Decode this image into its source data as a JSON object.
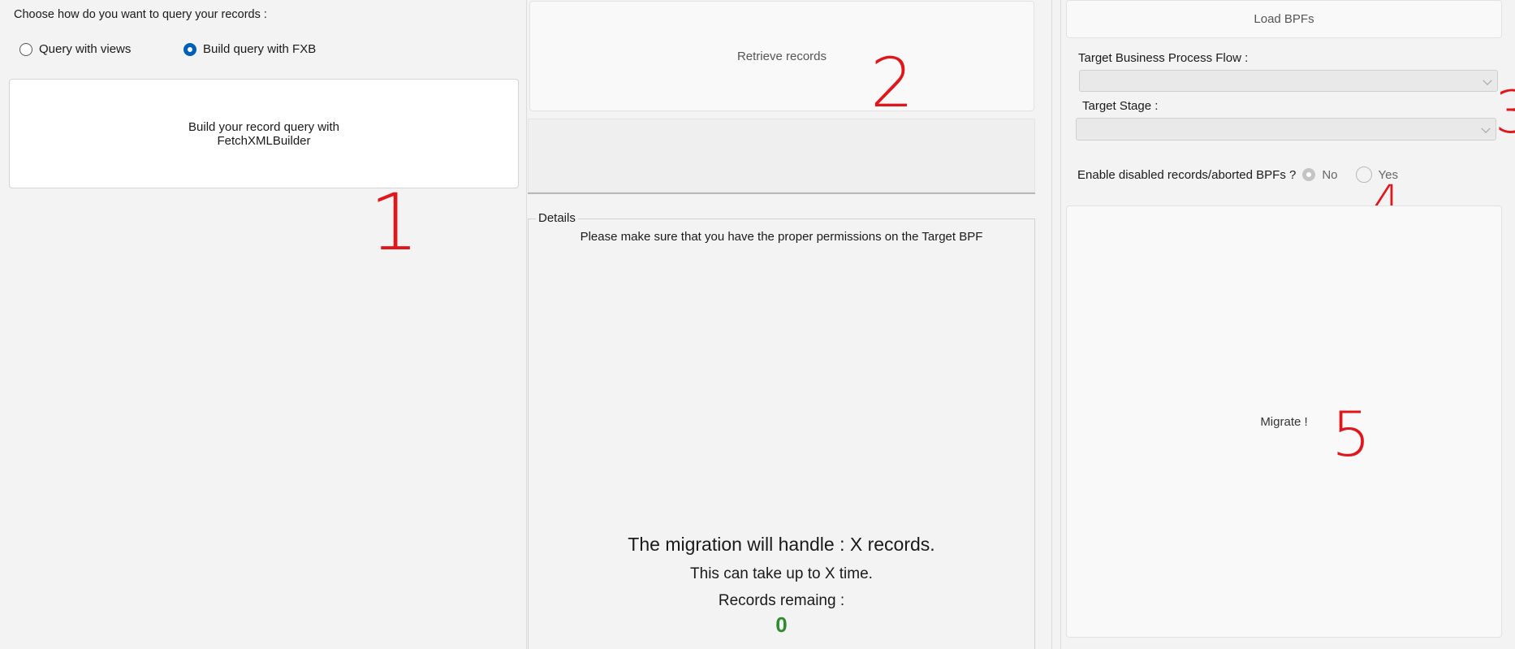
{
  "query_panel": {
    "prompt": "Choose how do you want to query your records :",
    "options": [
      {
        "label": "Query with views",
        "selected": false
      },
      {
        "label": "Build query with FXB",
        "selected": true
      }
    ],
    "build_button_line1": "Build your record query with",
    "build_button_line2": "FetchXMLBuilder"
  },
  "middle_panel": {
    "retrieve_button": "Retrieve records",
    "details_title": "Details",
    "details_notice": "Please make sure that you have the proper permissions on the Target BPF",
    "summary_line1": "The migration will handle : X records.",
    "summary_line2": "This can take up to X time.",
    "summary_line3": "Records remaing :",
    "records_remaining": "0"
  },
  "right_panel": {
    "load_button": "Load BPFs",
    "target_bpf_label": "Target Business Process Flow :",
    "target_bpf_value": "",
    "target_stage_label": "Target Stage :",
    "target_stage_value": "",
    "enable_label": "Enable disabled records/aborted BPFs ?",
    "enable_options": [
      {
        "label": "No",
        "selected": true
      },
      {
        "label": "Yes",
        "selected": false
      }
    ],
    "migrate_button": "Migrate !"
  },
  "annotations": [
    "1",
    "2",
    "3",
    "4",
    "5"
  ],
  "colors": {
    "accent": "#005fb8",
    "records_count": "#2e8b2e",
    "annotation": "#e0161b"
  }
}
